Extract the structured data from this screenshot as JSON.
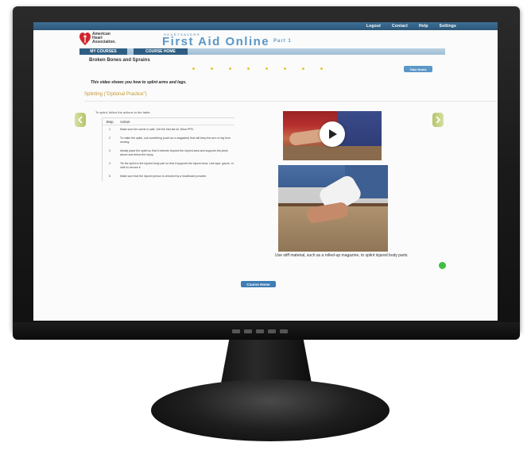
{
  "topnav": {
    "logout": "Logout",
    "contact": "Contact",
    "help": "Help",
    "settings": "Settings"
  },
  "org": {
    "line1": "American",
    "line2": "Heart",
    "line3": "Association."
  },
  "brand": {
    "small": "HEARTSAVER®",
    "title": "First Aid Online",
    "part": "Part 1"
  },
  "menu": {
    "my_courses": "MY COURSES",
    "course_home": "COURSE HOME"
  },
  "page": {
    "title": "Broken Bones and Sprains",
    "take_notes": "Take Notes",
    "intro": "This video shows you how to splint arms and legs.",
    "section_heading": "Splinting (\"Optional Practice\")"
  },
  "progress": {
    "dots": 8,
    "color": "#e0c83a"
  },
  "steps": {
    "lead": "To splint, follow the actions in the table:",
    "header_step": "Step",
    "header_action": "Action",
    "rows": [
      {
        "step": "1",
        "action": "Make sure the scene is safe. Get the first aid kit. Wear PPE."
      },
      {
        "step": "2",
        "action": "To make the splint, use something (such as a magazine) that will keep the arm or leg from moving."
      },
      {
        "step": "3",
        "action": "Ideally place the splint so that it extends beyond the injured area and supports the joints above and below the injury."
      },
      {
        "step": "4",
        "action": "Tie the splint to the injured body part so that it supports the injured area. Use tape, gauze, or cloth to secure it."
      },
      {
        "step": "5",
        "action": "Make sure that the injured person is checked by a healthcare provider."
      }
    ]
  },
  "media": {
    "caption": "Use stiff material, such as a rolled-up magazine, to splint injured body parts."
  },
  "footer": {
    "course_home": "Course Home"
  },
  "colors": {
    "brand_blue": "#5b97c8",
    "nav_dark": "#2f5e82",
    "heading_gold": "#c6962c",
    "arrow_green": "#b5c46a"
  }
}
